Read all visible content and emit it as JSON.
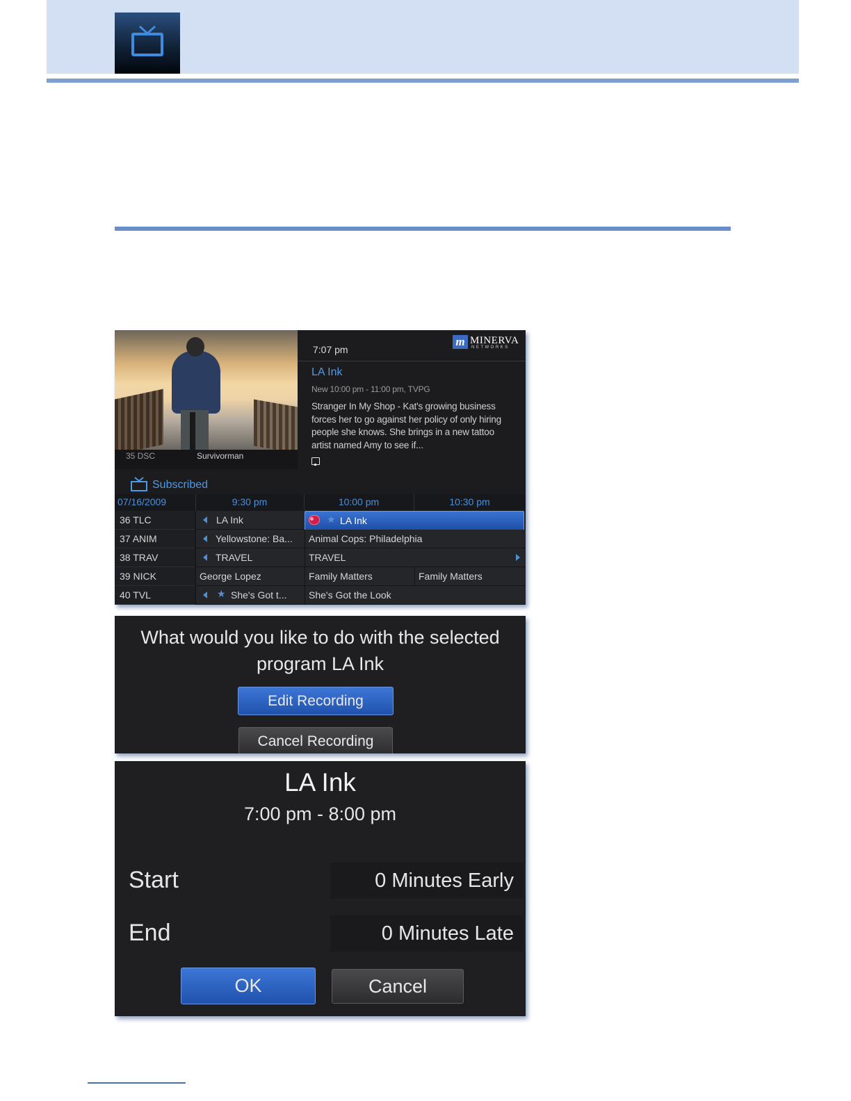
{
  "colors": {
    "header_band": "#d3dff2",
    "rule": "#7f9fd0",
    "accent_blue": "#4d9ae6",
    "selected_blue": "#2a5fbd",
    "record_red": "#d0204a"
  },
  "header": {
    "icon": "tv-icon"
  },
  "guide": {
    "video": {
      "channel": "35  DSC",
      "program": "Survivorman"
    },
    "clock": "7:07 pm",
    "logo": {
      "letter": "m",
      "word": "MINERVA",
      "sub": "NETWORKS"
    },
    "info": {
      "title": "LA Ink",
      "meta": "New 10:00 pm - 11:00 pm, TVPG",
      "description": "Stranger In My Shop - Kat's growing business forces her to go against her policy of only hiring people she knows. She brings in a new tattoo artist named Amy to see if...",
      "cc_icon": "closed-caption-icon"
    },
    "filter": {
      "icon": "tv-icon",
      "label": "Subscribed"
    },
    "timebar": {
      "date": "07/16/2009",
      "slots": [
        "9:30 pm",
        "10:00 pm",
        "10:30 pm"
      ]
    },
    "rows": [
      {
        "channel": "36 TLC",
        "cells": [
          "LA Ink",
          "LA Ink"
        ]
      },
      {
        "channel": "37 ANIM",
        "cells": [
          "Yellowstone: Ba...",
          "Animal Cops: Philadelphia"
        ]
      },
      {
        "channel": "38 TRAV",
        "cells": [
          "TRAVEL",
          "TRAVEL"
        ]
      },
      {
        "channel": "39 NICK",
        "cells": [
          "George Lopez",
          "Family Matters",
          "Family Matters"
        ]
      },
      {
        "channel": "40 TVL",
        "cells": [
          "She's Got t...",
          "She's Got the Look"
        ]
      }
    ]
  },
  "dialog": {
    "question_line1": "What would you like to do with the selected",
    "question_line2": "program LA Ink",
    "edit_label": "Edit Recording",
    "cancel_label": "Cancel Recording"
  },
  "edit": {
    "title": "LA Ink",
    "time": "7:00 pm -  8:00 pm",
    "start_label": "Start",
    "start_value": "0 Minutes Early",
    "end_label": "End",
    "end_value": "0 Minutes Late",
    "ok_label": "OK",
    "cancel_label": "Cancel"
  }
}
